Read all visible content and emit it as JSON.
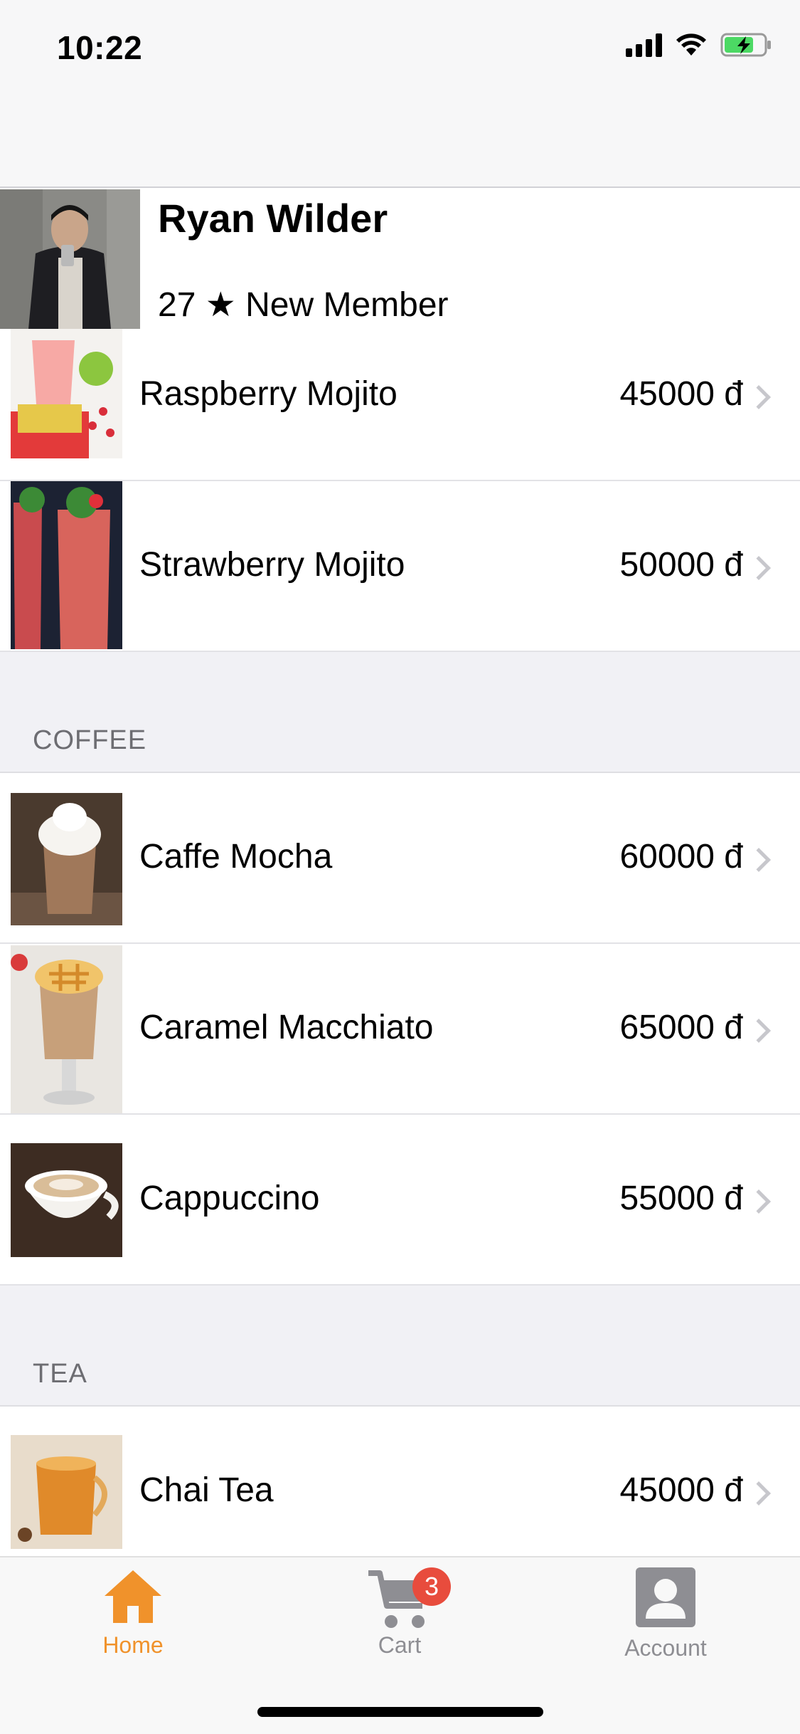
{
  "status_bar": {
    "time": "10:22"
  },
  "profile": {
    "name": "Ryan Wilder",
    "status": "27 ★ New Member"
  },
  "groups": [
    {
      "items": [
        {
          "name": "Raspberry Mojito",
          "price": "45000 đ"
        },
        {
          "name": "Strawberry Mojito",
          "price": "50000 đ"
        }
      ]
    },
    {
      "title": "COFFEE",
      "items": [
        {
          "name": "Caffe Mocha",
          "price": "60000 đ"
        },
        {
          "name": "Caramel Macchiato",
          "price": "65000 đ"
        },
        {
          "name": "Cappuccino",
          "price": "55000 đ"
        }
      ]
    },
    {
      "title": "TEA",
      "items": [
        {
          "name": "Chai Tea",
          "price": "45000 đ"
        }
      ]
    }
  ],
  "tabbar": {
    "home": "Home",
    "cart": "Cart",
    "cart_badge": "3",
    "account": "Account"
  },
  "colors": {
    "accent": "#f0922b",
    "inactive": "#8e8e93",
    "badge": "#e84c3d"
  }
}
